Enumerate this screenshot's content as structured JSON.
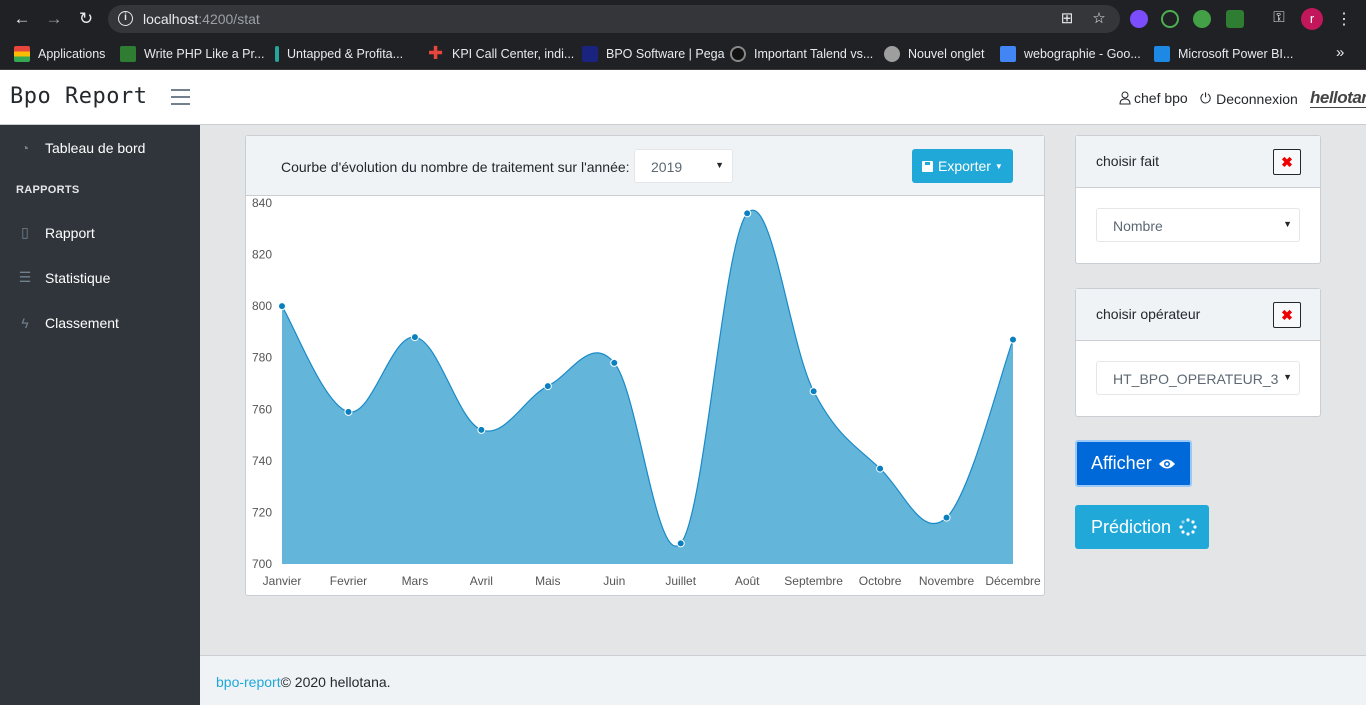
{
  "browser": {
    "url_host": "localhost",
    "url_path": ":4200/stat",
    "bookmarks": [
      {
        "label": "Applications",
        "color": "#e8453c"
      },
      {
        "label": "Write PHP Like a Pr...",
        "color": "#2e7d32"
      },
      {
        "label": "Untapped & Profita...",
        "color": "#26a69a"
      },
      {
        "label": "KPI Call Center, indi...",
        "color": "#e8453c"
      },
      {
        "label": "BPO Software | Pega",
        "color": "#1a237e"
      },
      {
        "label": "Important Talend vs...",
        "color": "#555555"
      },
      {
        "label": "Nouvel onglet",
        "color": "#9e9e9e"
      },
      {
        "label": "webographie - Goo...",
        "color": "#4285f4"
      },
      {
        "label": "Microsoft Power BI...",
        "color": "#1e88e5"
      }
    ],
    "profile_initial": "r"
  },
  "header": {
    "brand": "Bpo Report",
    "user": "chef bpo",
    "logout": "Deconnexion",
    "logo": "hellotana"
  },
  "sidebar": {
    "dashboard": "Tableau de bord",
    "section_title": "RAPPORTS",
    "items": [
      {
        "label": "Rapport",
        "icon": "file-icon"
      },
      {
        "label": "Statistique",
        "icon": "list-icon"
      },
      {
        "label": "Classement",
        "icon": "bolt-icon"
      }
    ]
  },
  "chart_card": {
    "title": "Courbe d'évolution du nombre de traitement sur l'année:",
    "year": "2019",
    "export_label": "Exporter"
  },
  "chart_data": {
    "type": "area",
    "categories": [
      "Janvier",
      "Fevrier",
      "Mars",
      "Avril",
      "Mais",
      "Juin",
      "Juillet",
      "Août",
      "Septembre",
      "Octobre",
      "Novembre",
      "Décembre"
    ],
    "series": [
      {
        "values": [
          800,
          759,
          788,
          752,
          769,
          778,
          708,
          836,
          767,
          737,
          718,
          787
        ]
      }
    ],
    "ylim": [
      700,
      840
    ],
    "yticks": [
      700,
      720,
      740,
      760,
      780,
      800,
      820,
      840
    ],
    "fill_color": "#63b5da",
    "line_color": "#1a8ac7",
    "grid": false
  },
  "panels": {
    "fait": {
      "title": "choisir fait",
      "selected": "Nombre",
      "close": "✖"
    },
    "operateur": {
      "title": "choisir opérateur",
      "selected": "HT_BPO_OPERATEUR_3",
      "close": "✖"
    }
  },
  "buttons": {
    "afficher": "Afficher",
    "prediction": "Prédiction"
  },
  "footer": {
    "link": "bpo-report",
    "text": "© 2020 hellotana."
  }
}
